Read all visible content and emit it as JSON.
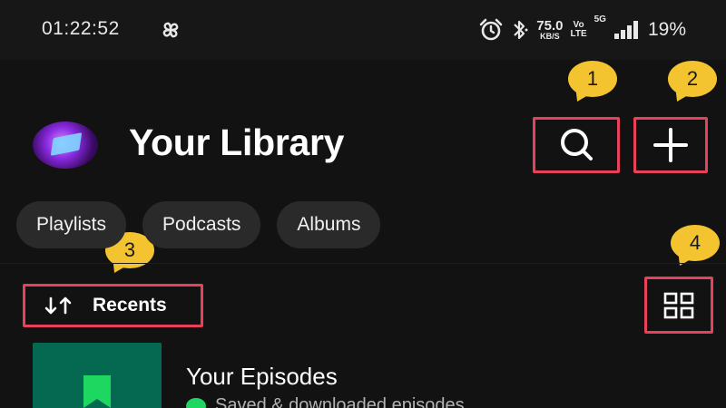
{
  "status_bar": {
    "time": "01:22:52",
    "net_speed_value": "75.0",
    "net_speed_unit": "KB/S",
    "volte_top": "Vo",
    "volte_bottom": "LTE",
    "network": "5G",
    "battery": "19%",
    "icons": [
      "pinwheel-app-icon",
      "alarm-icon",
      "bluetooth-icon",
      "signal-icon"
    ]
  },
  "header": {
    "title": "Your Library",
    "search_icon": "search-icon",
    "add_icon": "plus-icon"
  },
  "filters": [
    "Playlists",
    "Podcasts",
    "Albums"
  ],
  "sort": {
    "label": "Recents",
    "icon": "sort-arrows-icon"
  },
  "view_toggle_icon": "grid-view-icon",
  "callouts": [
    "1",
    "2",
    "3",
    "4"
  ],
  "library_items": [
    {
      "title": "Your Episodes",
      "subtitle": "Saved & downloaded episodes",
      "icon": "bookmark-icon"
    }
  ],
  "colors": {
    "highlight": "#e8415a",
    "callout": "#f4c430",
    "episodes_cover": "#056952",
    "accent_green": "#1ed760",
    "background": "#121212"
  }
}
